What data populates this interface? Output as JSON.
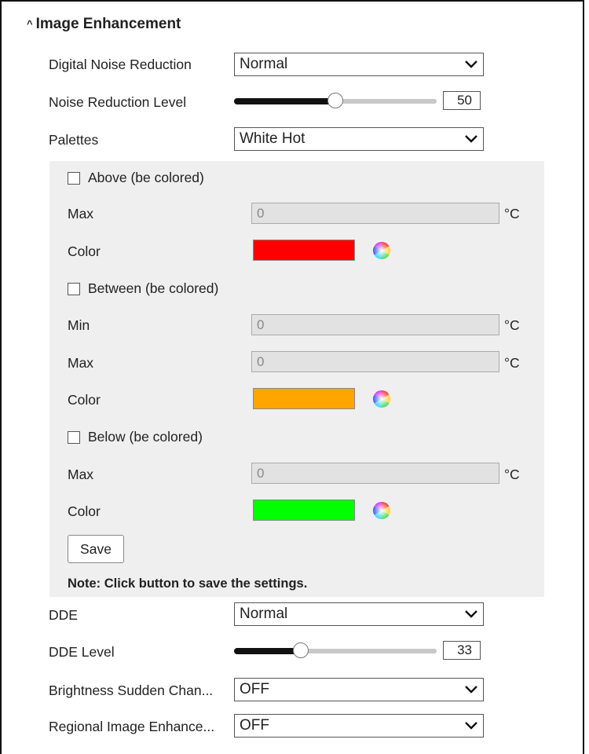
{
  "section": {
    "title": "Image Enhancement"
  },
  "dnr": {
    "label": "Digital Noise Reduction",
    "value": "Normal"
  },
  "nrl": {
    "label": "Noise Reduction Level",
    "value": "50",
    "fraction": 0.5
  },
  "palettes": {
    "label": "Palettes",
    "value": "White Hot"
  },
  "above": {
    "label": "Above (be colored)",
    "max_label": "Max",
    "max_value": "0",
    "unit": "°C",
    "color_label": "Color",
    "color": "#ff0000"
  },
  "between": {
    "label": "Between (be colored)",
    "min_label": "Min",
    "min_value": "0",
    "min_unit": "°C",
    "max_label": "Max",
    "max_value": "0",
    "max_unit": "°C",
    "color_label": "Color",
    "color": "#ffa500"
  },
  "below": {
    "label": "Below (be colored)",
    "max_label": "Max",
    "max_value": "0",
    "unit": "°C",
    "color_label": "Color",
    "color": "#00ff00"
  },
  "save": {
    "label": "Save",
    "note": "Note: Click button to save the settings."
  },
  "dde": {
    "label": "DDE",
    "value": "Normal"
  },
  "dde_level": {
    "label": "DDE Level",
    "value": "33",
    "fraction": 0.33
  },
  "brightness": {
    "label": "Brightness Sudden Chan...",
    "value": "OFF"
  },
  "regional": {
    "label": "Regional Image Enhance...",
    "value": "OFF"
  },
  "icons": {
    "caret": "caret-up-icon",
    "dropdown": "chevron-down-icon",
    "picker": "color-wheel-icon"
  }
}
